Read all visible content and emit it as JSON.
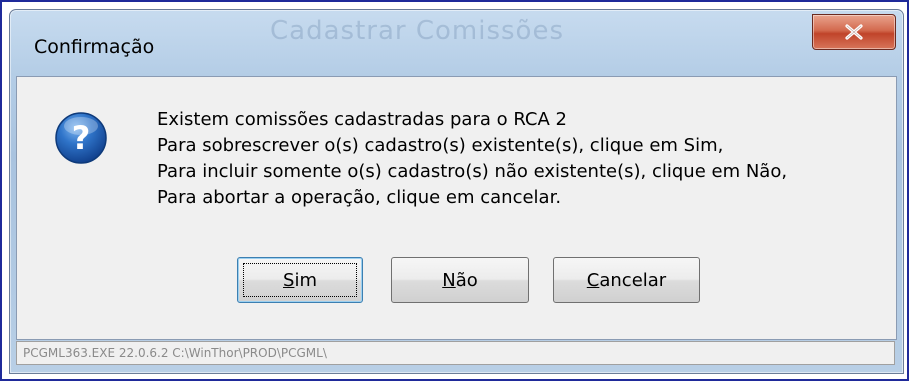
{
  "window": {
    "title": "Confirmação",
    "background_title": "Cadastrar Comissões",
    "close_icon": "close-icon"
  },
  "dialog": {
    "icon": "question-icon",
    "message_lines": [
      "Existem comissões cadastradas para o RCA 2",
      "Para sobrescrever o(s) cadastro(s) existente(s), clique em Sim,",
      "Para incluir somente o(s) cadastro(s) não existente(s), clique em Não,",
      "Para abortar a operação, clique em cancelar."
    ],
    "buttons": {
      "yes": {
        "mnemonic": "S",
        "rest": "im"
      },
      "no": {
        "mnemonic": "N",
        "rest": "ão"
      },
      "cancel": {
        "mnemonic": "C",
        "rest": "ancelar"
      }
    }
  },
  "status": {
    "text": "PCGML363.EXE 22.0.6.2 C:\\WinThor\\PROD\\PCGML\\"
  },
  "colors": {
    "frame_border": "#1f2a9a",
    "close_button": "#c7452c",
    "question_icon": "#1f5fae"
  }
}
